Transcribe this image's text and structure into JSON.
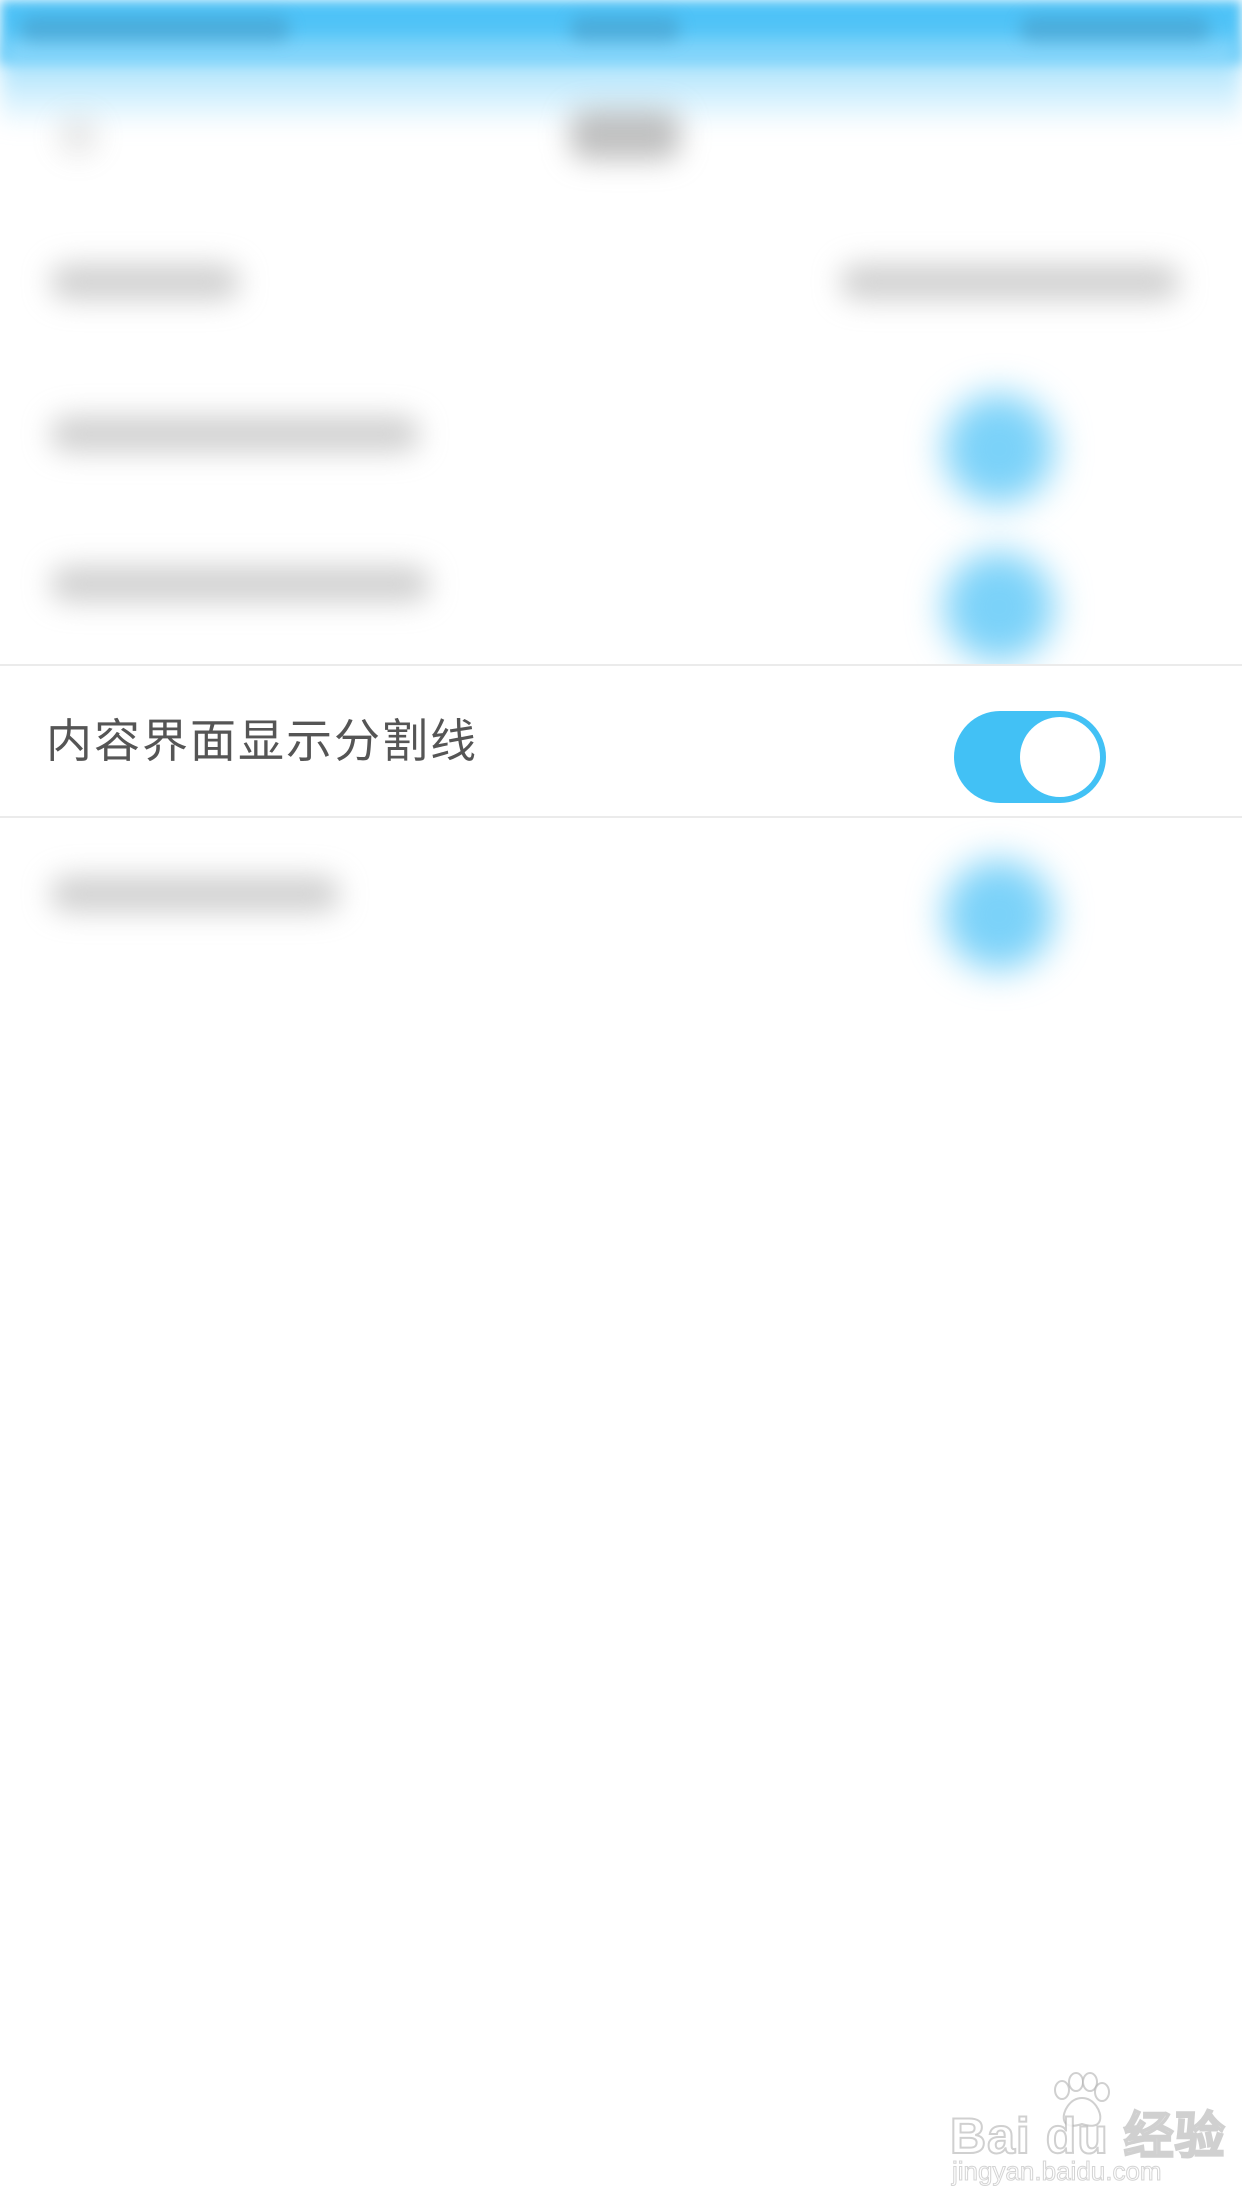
{
  "settings_row": {
    "label": "内容界面显示分割线",
    "toggle_on": true
  },
  "colors": {
    "accent": "#42c1f5",
    "status_bar": "#4fc3f7",
    "label_text": "#555555",
    "divider": "#ebebeb"
  },
  "watermark": {
    "brand": "Bai du 经验",
    "url": "jingyan.baidu.com",
    "icon": "baidu-paw-icon"
  }
}
